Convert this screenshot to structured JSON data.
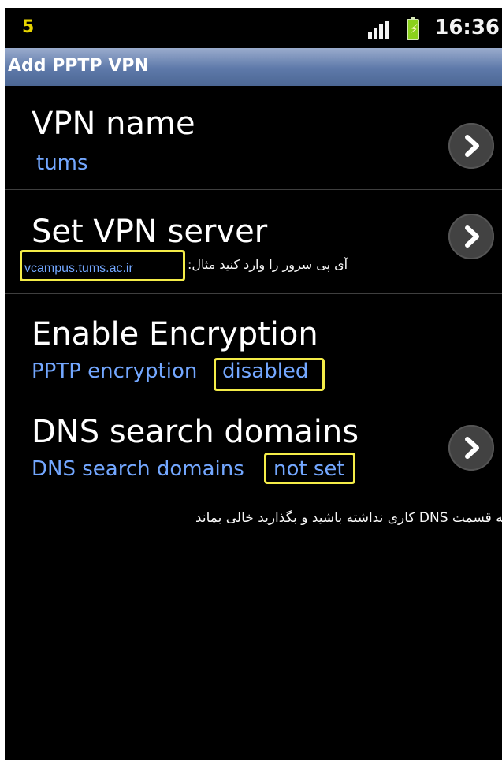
{
  "status_bar": {
    "notification_count": "5",
    "time": "16:36"
  },
  "title_bar": {
    "title": "Add PPTP VPN"
  },
  "vpn_name": {
    "label": "VPN name",
    "value": "tums"
  },
  "vpn_server": {
    "label": "Set VPN server",
    "value": "vcampus.tums.ac.ir",
    "persian_hint": "آی پی سرور را وارد کنید مثال:"
  },
  "encryption": {
    "label": "Enable Encryption",
    "prefix": "PPTP encryption",
    "value": "disabled"
  },
  "dns": {
    "label": "DNS search domains",
    "prefix": "DNS search domains",
    "value": "not set",
    "note": "به قسمت DNS کاری نداشته باشید و بگذارید خالی بماند"
  },
  "colors": {
    "title_bar": "#5e79aa",
    "accent_text": "#73a7ff",
    "highlight_box": "#f4ec48",
    "status_number": "#e7d400"
  },
  "icons": {
    "signal": "signal-icon",
    "battery": "battery-icon",
    "chevron": "chevron-right-icon"
  }
}
